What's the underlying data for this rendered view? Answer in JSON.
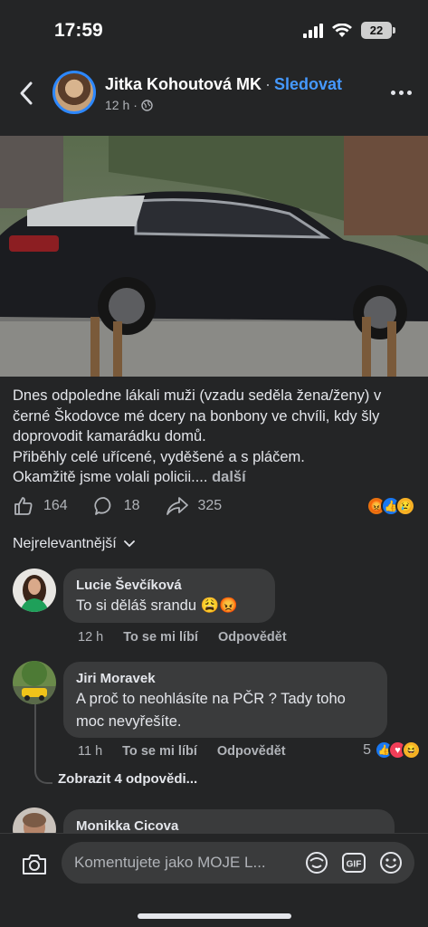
{
  "status_bar": {
    "time": "17:59",
    "battery": "22"
  },
  "header": {
    "author": "Jitka Kohoutová MK",
    "separator": "·",
    "follow_label": "Sledovat",
    "time_ago": "12 h",
    "meta_separator": "·"
  },
  "post": {
    "text": "Dnes odpoledne lákali muži (vzadu seděla žena/ženy) v černé Škodovce mé dcery na bonbony ve chvíli, kdy šly doprovodit kamarádku domů.",
    "text2": "Přiběhly celé uřícené, vyděšené a s pláčem.",
    "text3": "Okamžitě jsme volali policii....",
    "more_label": "další",
    "likes": "164",
    "comments": "18",
    "shares": "325"
  },
  "sort_label": "Nejrelevantnější",
  "comments": [
    {
      "name": "Lucie Ševčíková",
      "text": "To si děláš srandu 😩😡",
      "time": "12 h",
      "like_label": "To se mi líbí",
      "reply_label": "Odpovědět"
    },
    {
      "name": "Jiri Moravek",
      "text_line1": "A proč to neohlásíte na PČR ? Tady toho",
      "text_line2": "moc nevyřešíte.",
      "time": "11 h",
      "like_label": "To se mi líbí",
      "reply_label": "Odpovědět",
      "reaction_count": "5",
      "replies_label": "Zobrazit 4 odpovědi..."
    },
    {
      "name": "Monikka Cicova"
    }
  ],
  "composer": {
    "placeholder": "Komentujete jako MOJE L...",
    "gif_label": "GIF"
  },
  "colors": {
    "accent": "#4599ff",
    "background": "#242526",
    "bubble": "#3a3b3c"
  }
}
